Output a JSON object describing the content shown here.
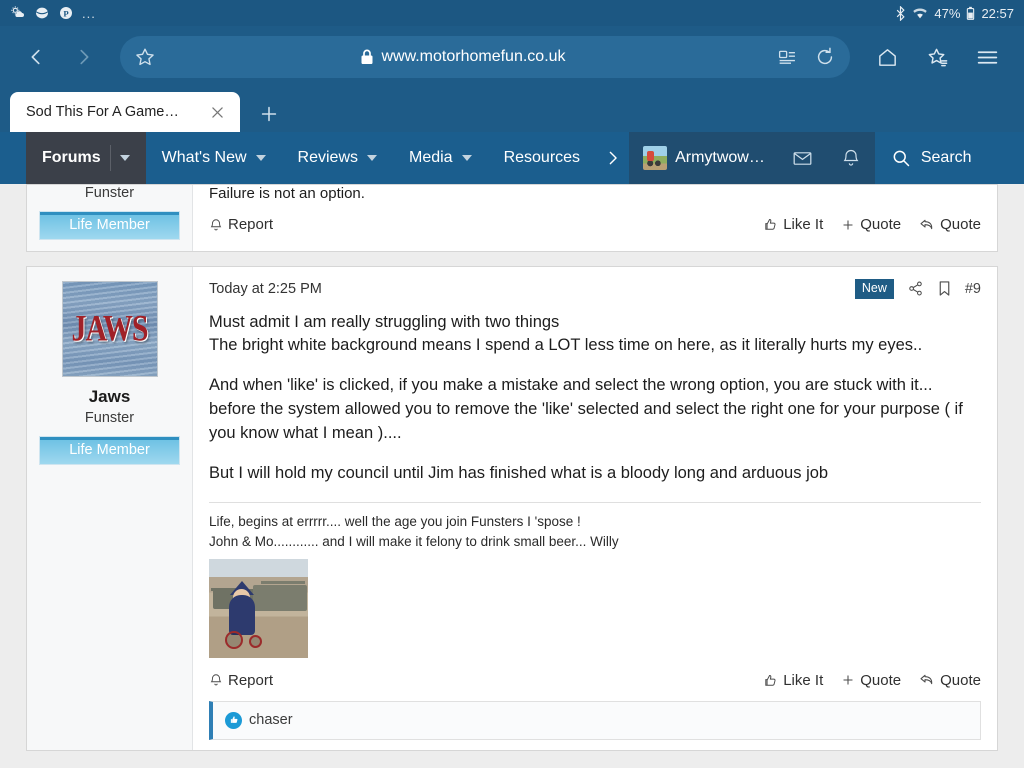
{
  "status_bar": {
    "icons": [
      "weather-icon",
      "samsung-internet-icon",
      "pinterest-icon"
    ],
    "overflow": "...",
    "right_icons": [
      "bluetooth-icon",
      "wifi-icon",
      "battery-icon"
    ],
    "battery": "47%",
    "clock": "22:57"
  },
  "browser": {
    "url": "www.motorhomefun.co.uk",
    "lock": "🔒",
    "back_label": "Back",
    "forward_label": "Forward",
    "tab": {
      "title": "Sod This For A Game…",
      "close_label": "×",
      "new_tab_label": "+"
    }
  },
  "site_nav": {
    "items": [
      {
        "label": "Forums",
        "has_caret": true,
        "active": true
      },
      {
        "label": "What's New",
        "has_caret": true,
        "active": false
      },
      {
        "label": "Reviews",
        "has_caret": true,
        "active": false
      },
      {
        "label": "Media",
        "has_caret": true,
        "active": false
      },
      {
        "label": "Resources",
        "has_caret": false,
        "active": false
      }
    ],
    "overflow_chevron": "›",
    "user": "Armytwow…",
    "inbox_label": "Inbox",
    "alerts_label": "Alerts",
    "search_label": "Search"
  },
  "previous_post": {
    "user_title": "Funster",
    "user_banner": "Life Member",
    "signature_line": "Failure is not an option",
    "signature_tail": ".",
    "report_label": "Report",
    "like_label": "Like It",
    "quote_plus_label": "Quote",
    "quote_reply_label": "Quote"
  },
  "post": {
    "avatar_text": "JAWS",
    "username": "Jaws",
    "user_title": "Funster",
    "user_banner": "Life Member",
    "date": "Today at 2:25 PM",
    "badge_new": "New",
    "share_label": "Share",
    "bookmark_label": "Bookmark",
    "post_number": "#9",
    "body": [
      "Must admit I am really struggling with two things\nThe bright white background means I spend a LOT less time on here, as it literally hurts my eyes..",
      "And when 'like' is clicked, if you make a mistake and select the wrong option, you are stuck with it... before the system allowed you to remove the 'like' selected and select the right one for your purpose ( if you know what I mean )....",
      "But I will hold my council until Jim has finished what is a bloody long and arduous job"
    ],
    "signature": [
      "Life, begins at errrrr.... well the age you join Funsters I 'spose !",
      "John & Mo............ and I will make it felony to drink small beer... Willy"
    ],
    "signature_image_alt": "wizard-on-tricycle-with-tanks",
    "report_label": "Report",
    "like_label": "Like It",
    "quote_plus_label": "Quote",
    "quote_reply_label": "Quote",
    "reaction_user": "chaser"
  },
  "colors": {
    "status_bar": "#1c5782",
    "browser_bar": "#1e5b87",
    "site_nav": "#1b5e8e",
    "nav_active": "#3b4049",
    "badge_new": "#1f5c85",
    "banner": "#9fd8ef",
    "reaction_blue": "#1c9ad6"
  }
}
